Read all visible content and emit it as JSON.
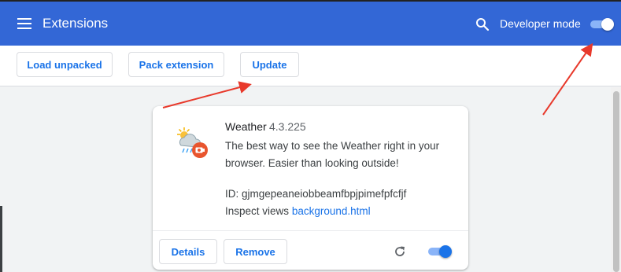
{
  "header": {
    "title": "Extensions",
    "developer_mode_label": "Developer mode",
    "developer_mode_on": true,
    "background_color": "#3367d6"
  },
  "toolbar": {
    "load_unpacked_label": "Load unpacked",
    "pack_extension_label": "Pack extension",
    "update_label": "Update"
  },
  "extension": {
    "name": "Weather",
    "version": "4.3.225",
    "description": "The best way to see the Weather right in your browser. Easier than looking outside!",
    "id_text": "ID: gjmgepeaneiobbeamfbpjpimefpfcfjf",
    "inspect_label": "Inspect views",
    "inspect_link": "background.html",
    "details_label": "Details",
    "remove_label": "Remove",
    "enabled": true,
    "icon": "weather-cloud-sun-icon"
  },
  "annotations": {
    "arrow_color": "#e8392b"
  }
}
